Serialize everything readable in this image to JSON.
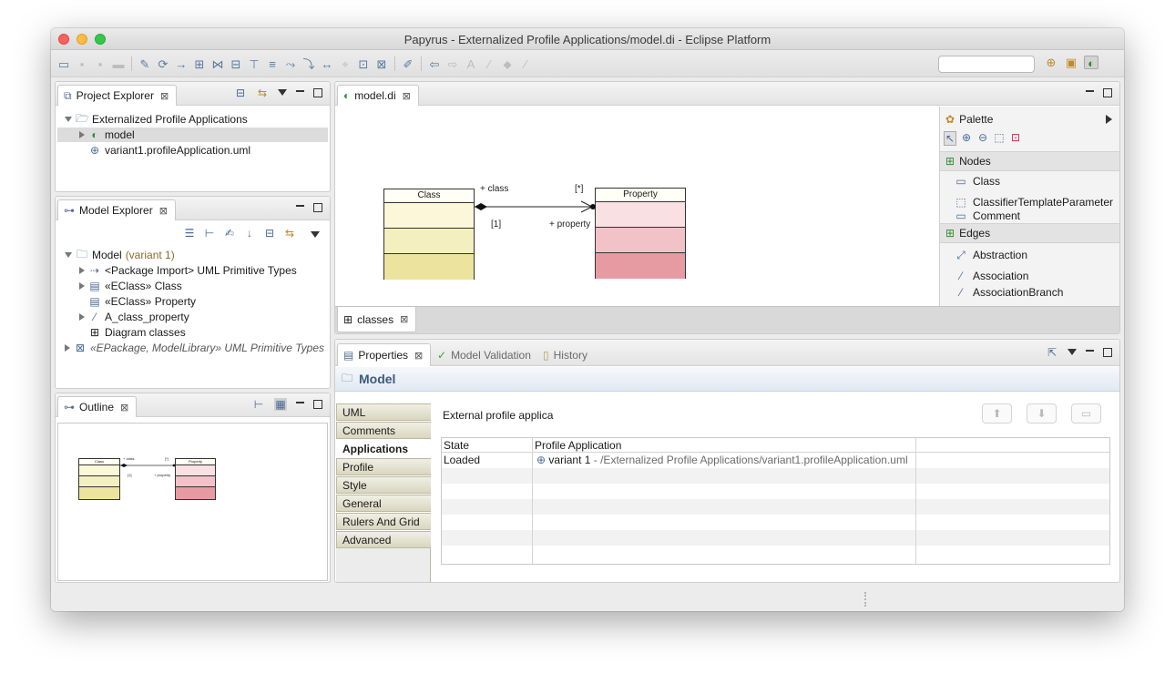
{
  "window": {
    "title": "Papyrus - Externalized Profile Applications/model.di - Eclipse Platform"
  },
  "toolbar": {
    "search_value": ""
  },
  "project_explorer": {
    "tab_label": "Project Explorer",
    "items": [
      {
        "label": "Externalized Profile Applications"
      },
      {
        "label": "model"
      },
      {
        "label": "variant1.profileApplication.uml"
      }
    ]
  },
  "model_explorer": {
    "tab_label": "Model Explorer",
    "root": {
      "label": "Model",
      "suffix": "(variant 1)"
    },
    "items": [
      {
        "label": "<Package Import> UML Primitive Types"
      },
      {
        "label": "«EClass» Class"
      },
      {
        "label": "«EClass» Property"
      },
      {
        "label": "A_class_property"
      },
      {
        "label": "Diagram classes"
      }
    ],
    "external": {
      "label": "«EPackage, ModelLibrary» UML Primitive Types"
    }
  },
  "outline": {
    "tab_label": "Outline",
    "mini": {
      "class_label": "Class",
      "property_label": "Property",
      "role_class": "+ class",
      "mult_star": "[*]",
      "mult_one": "[1]",
      "role_property": "+ property"
    }
  },
  "editor": {
    "tab_label": "model.di",
    "sheet_tab_label": "classes",
    "diagram": {
      "class_name": "Class",
      "property_name": "Property",
      "role_class": "+ class",
      "mult_star": "[*]",
      "mult_one": "[1]",
      "role_property": "+ property"
    }
  },
  "palette": {
    "title": "Palette",
    "nodes_title": "Nodes",
    "nodes": [
      {
        "label": "Class"
      },
      {
        "label": "ClassifierTemplateParameter"
      },
      {
        "label": "Comment"
      }
    ],
    "edges_title": "Edges",
    "edges": [
      {
        "label": "Abstraction"
      },
      {
        "label": "Association"
      },
      {
        "label": "AssociationBranch"
      }
    ]
  },
  "properties": {
    "tabs": [
      {
        "label": "Properties"
      },
      {
        "label": "Model Validation"
      },
      {
        "label": "History"
      }
    ],
    "heading": "Model",
    "side_tabs": [
      "UML",
      "Comments",
      "Applications",
      "Profile",
      "Style",
      "General",
      "Rulers And Grid",
      "Advanced"
    ],
    "active_side_tab": "Applications",
    "section_label": "External profile applica",
    "table": {
      "columns": [
        "State",
        "Profile Application",
        ""
      ],
      "rows": [
        {
          "state": "Loaded",
          "name": "variant 1",
          "path": " - /Externalized Profile Applications/variant1.profileApplication.uml"
        }
      ]
    }
  }
}
